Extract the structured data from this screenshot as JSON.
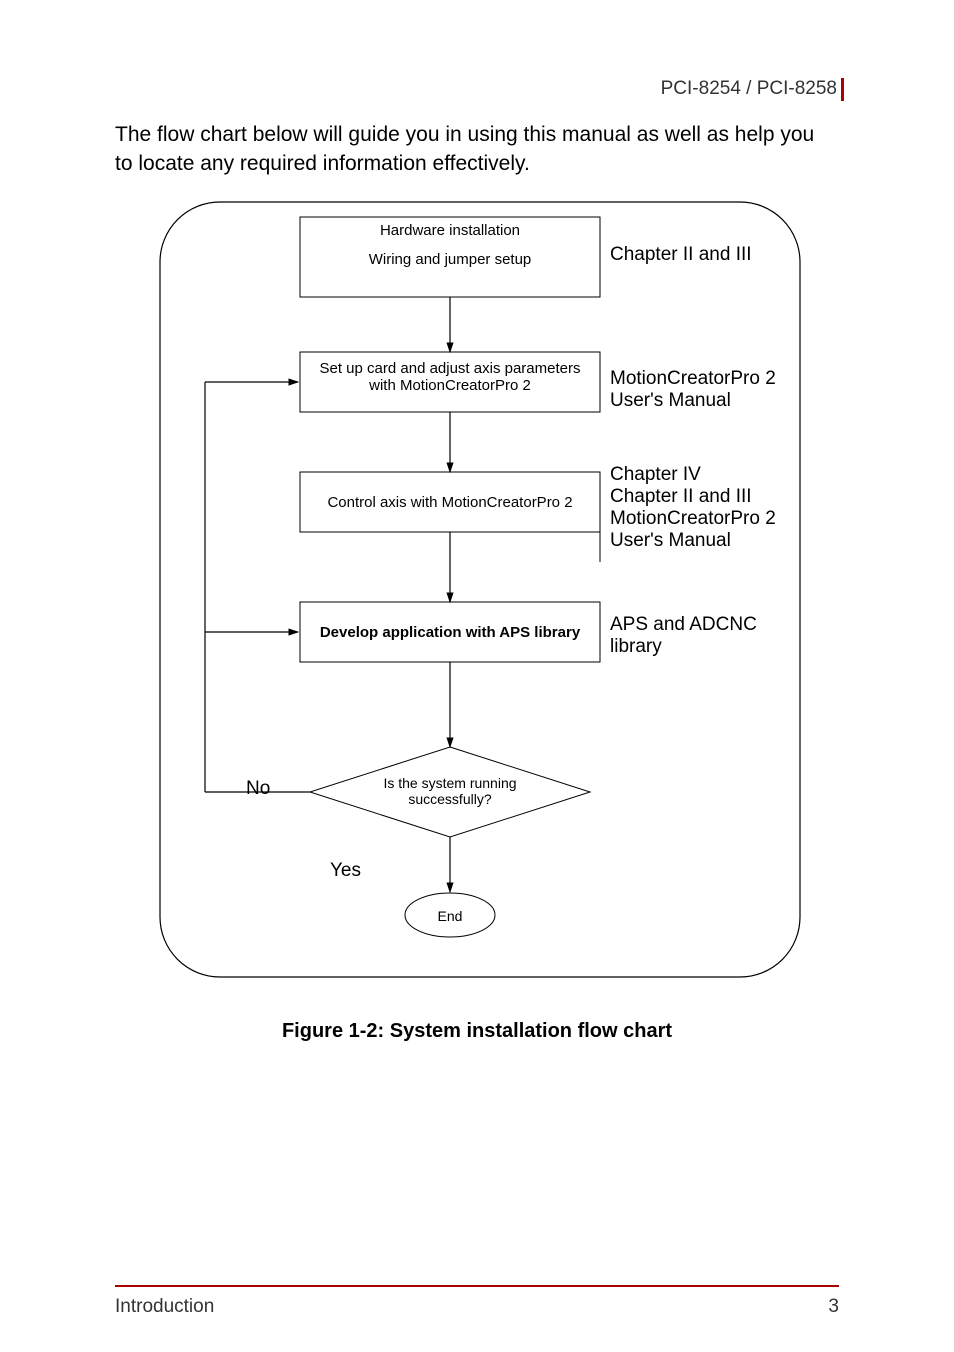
{
  "header": {
    "title": "PCI-8254 / PCI-8258"
  },
  "intro": "The flow chart below will guide you in using this manual as well as help you to locate any required information effectively.",
  "flow": {
    "box1_line1": "Hardware installation",
    "box1_line2": "Wiring and jumper setup",
    "box2": "Set up card and adjust axis parameters with MotionCreatorPro 2",
    "box3": "Control axis with MotionCreatorPro 2",
    "box4": "Develop application with APS library",
    "decision": "Is the system running successfully?",
    "end": "End",
    "no": "No",
    "yes": "Yes",
    "annot1": "Chapter II and III",
    "annot2": "MotionCreatorPro 2 User's Manual",
    "annot3_l1": "Chapter IV",
    "annot3_l2": "Chapter II and III",
    "annot3_l3": "MotionCreatorPro 2 User's Manual",
    "annot4": "APS and ADCNC library"
  },
  "caption": "Figure 1-2: System installation flow chart",
  "footer": {
    "left": "Introduction",
    "right": "3"
  }
}
